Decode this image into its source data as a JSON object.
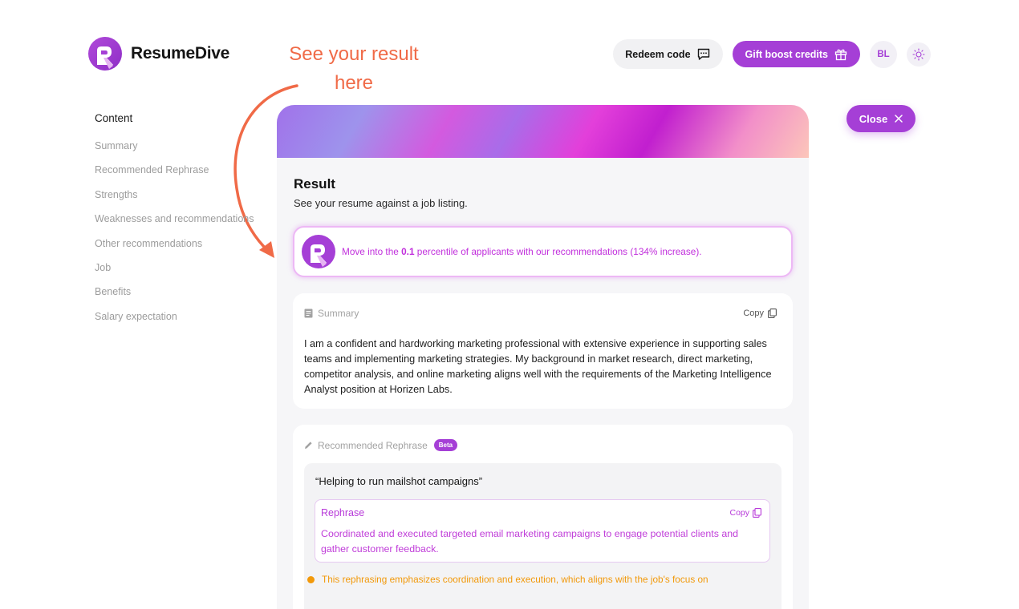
{
  "app": {
    "name": "ResumeDive"
  },
  "annotation": {
    "line1": "See your result",
    "line2": "here"
  },
  "header": {
    "redeem_label": "Redeem code",
    "gift_label": "Gift boost credits",
    "avatar_initials": "BL"
  },
  "sidebar": {
    "title": "Content",
    "items": [
      {
        "label": "Summary"
      },
      {
        "label": "Recommended Rephrase"
      },
      {
        "label": "Strengths"
      },
      {
        "label": "Weaknesses and recommendations"
      },
      {
        "label": "Other recommendations"
      },
      {
        "label": "Job"
      },
      {
        "label": "Benefits"
      },
      {
        "label": "Salary expectation"
      }
    ]
  },
  "close_label": "Close",
  "result": {
    "title": "Result",
    "subtitle": "See your resume against a job listing.",
    "promo": {
      "prefix": "Move into the ",
      "percentile": "0.1",
      "suffix": " percentile of applicants with our recommendations (134% increase)."
    },
    "summary": {
      "label": "Summary",
      "copy_label": "Copy",
      "text": "I am a confident and hardworking marketing professional with extensive experience in supporting sales teams and implementing marketing strategies. My background in market research, direct marketing, competitor analysis, and online marketing aligns well with the requirements of the Marketing Intelligence Analyst position at Horizen Labs."
    },
    "rephrase": {
      "label": "Recommended Rephrase",
      "badge": "Beta",
      "original": "“Helping to run mailshot campaigns”",
      "box_label": "Rephrase",
      "copy_label": "Copy",
      "text": "Coordinated and executed targeted email marketing campaigns to engage potential clients and gather customer feedback.",
      "note": "This rephrasing emphasizes coordination and execution, which aligns with the job's focus on"
    }
  },
  "colors": {
    "brand": "#a53fd6",
    "annotation": "#f06a47",
    "promo_text": "#c12fdc",
    "note": "#f2990a"
  }
}
